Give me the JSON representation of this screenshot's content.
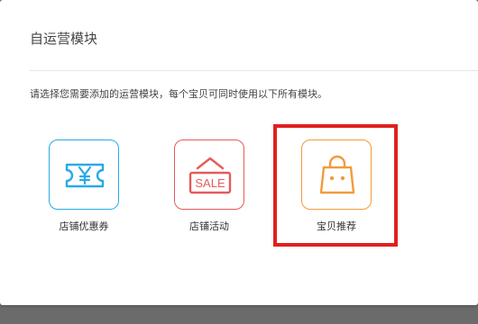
{
  "dialog": {
    "title": "自运营模块",
    "instruction": "请选择您需要添加的运营模块，每个宝贝可同时使用以下所有模块。"
  },
  "modules": [
    {
      "label": "店铺优惠券",
      "icon": "coupon-icon",
      "color": "#29a9e8"
    },
    {
      "label": "店铺活动",
      "icon": "sale-sign-icon",
      "color": "#e65a5a",
      "icon_text": "SALE"
    },
    {
      "label": "宝贝推荐",
      "icon": "shopping-bag-icon",
      "color": "#f39a3b"
    }
  ],
  "highlight": {
    "color": "#e0201f",
    "target": "宝贝推荐"
  }
}
